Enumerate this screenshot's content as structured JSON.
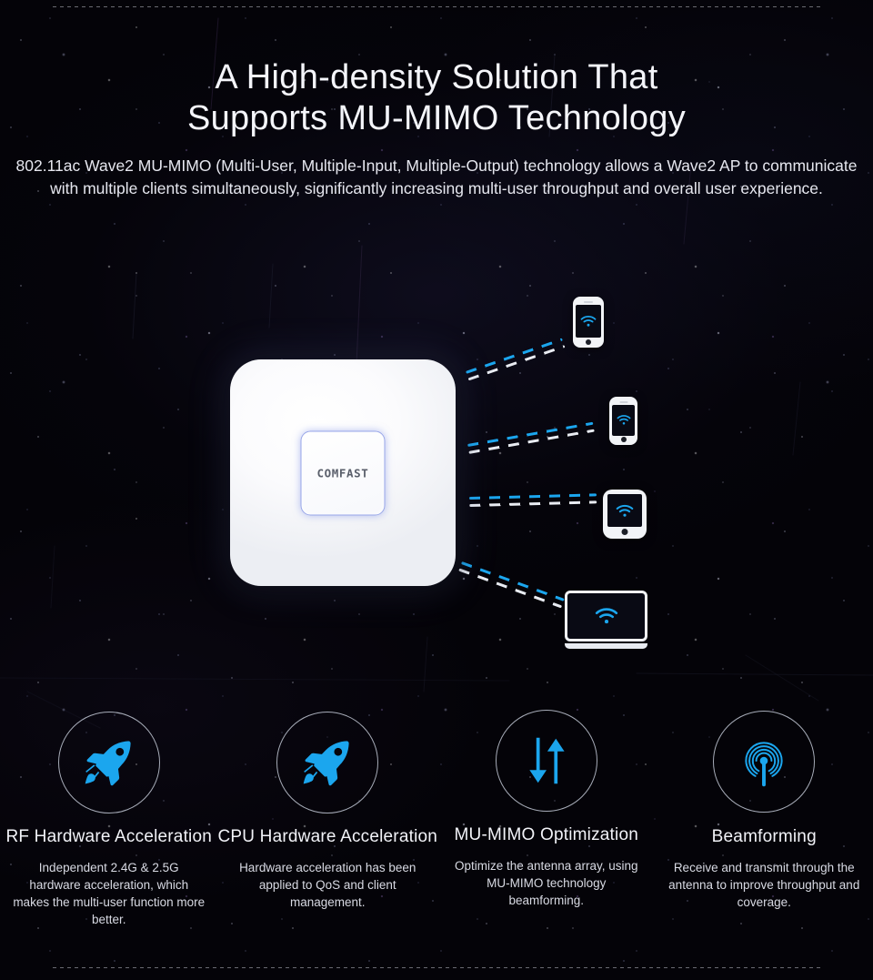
{
  "hero": {
    "title_line1": "A High-density Solution That",
    "title_line2": "Supports MU-MIMO Technology",
    "paragraph": "802.11ac Wave2 MU-MIMO (Multi-User, Multiple-Input, Multiple-Output) technology allows a Wave2 AP to communicate with multiple clients simultaneously, significantly increasing multi-user throughput and overall user experience."
  },
  "device": {
    "brand_logo": "COMFAST",
    "name": "wireless-access-point"
  },
  "clients": [
    {
      "name": "smartphone-top",
      "icon": "wifi-icon"
    },
    {
      "name": "smartphone-middle",
      "icon": "wifi-icon"
    },
    {
      "name": "tablet",
      "icon": "wifi-icon"
    },
    {
      "name": "laptop",
      "icon": "wifi-icon"
    }
  ],
  "features": [
    {
      "icon": "rocket-icon",
      "title": "RF Hardware Acceleration",
      "description": "Independent 2.4G & 2.5G hardware acceleration, which makes the multi-user function more better."
    },
    {
      "icon": "rocket-icon",
      "title": "CPU Hardware Acceleration",
      "description": "Hardware acceleration has been applied to QoS and client management."
    },
    {
      "icon": "up-down-arrows-icon",
      "title": "MU-MIMO Optimization",
      "description": "Optimize the antenna array, using MU-MIMO technology beamforming."
    },
    {
      "icon": "broadcast-antenna-icon",
      "title": "Beamforming",
      "description": "Receive and transmit through the antenna to improve throughput and coverage."
    }
  ],
  "colors": {
    "accent_blue": "#1ba6ee",
    "background": "#040308",
    "heading_text": "#f4f5fa",
    "body_text": "#e6e7ef",
    "circle_border": "#a7acb8"
  }
}
